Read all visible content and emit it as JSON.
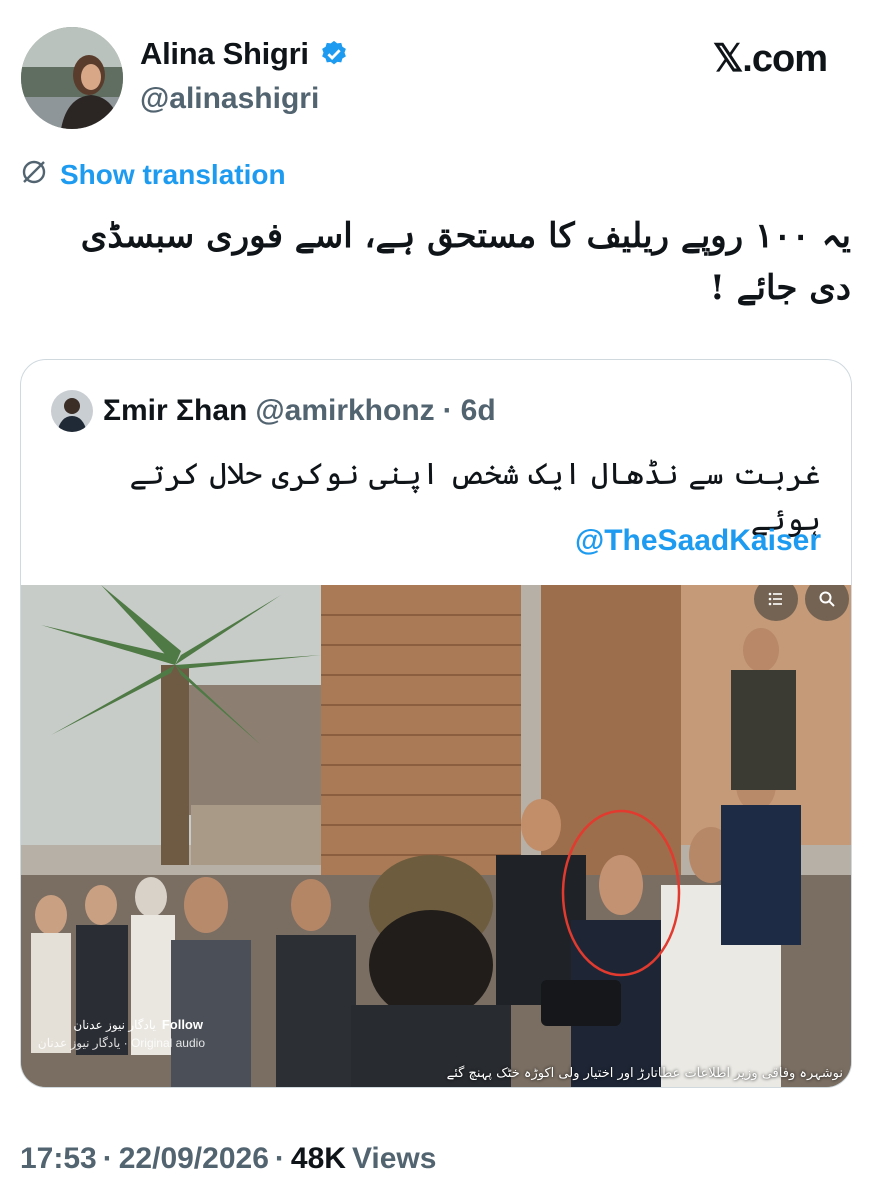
{
  "author": {
    "name": "Alina Shigri",
    "handle": "@alinashigri"
  },
  "brand": {
    "label": "𝕏.com"
  },
  "translation": {
    "label": "Show translation"
  },
  "tweet": {
    "text": "یہ ۱۰۰ روپے ریلیف کا مستحق ہے، اسے فوری سبسڈی دی جائے !"
  },
  "quote": {
    "name": "Σmir Σhan",
    "handle": "@amirkhonz",
    "separator": "·",
    "age": "6d",
    "text": "غربت سے نڈھال ایک شخص اپنی نوکری حلال کرتے ہوئے",
    "mention": "@TheSaadKaiser",
    "media": {
      "follow_page": "یادگار نیوز عدنان",
      "follow_label": "Follow",
      "audio_label": "یادگار نیوز عدنان · Original audio",
      "caption": "نوشہرہ وفاقی وزیر اطلاعات عطاتارڑ اور اختیار ولی اکوڑہ خٹک پہنچ گئے"
    }
  },
  "meta": {
    "time": "17:53",
    "sep1": "·",
    "date": "22/09/2026",
    "sep2": "·",
    "views_count": "48K",
    "views_label": "Views"
  },
  "colors": {
    "accent": "#1d9bf0",
    "muted": "#536471",
    "text": "#0f1419",
    "border": "#cfd9de",
    "highlight_circle": "#e23a2e"
  },
  "icons": {
    "verified": "verified-badge-icon",
    "translate": "globe-slash-icon",
    "menu": "list-icon",
    "search": "search-icon"
  }
}
